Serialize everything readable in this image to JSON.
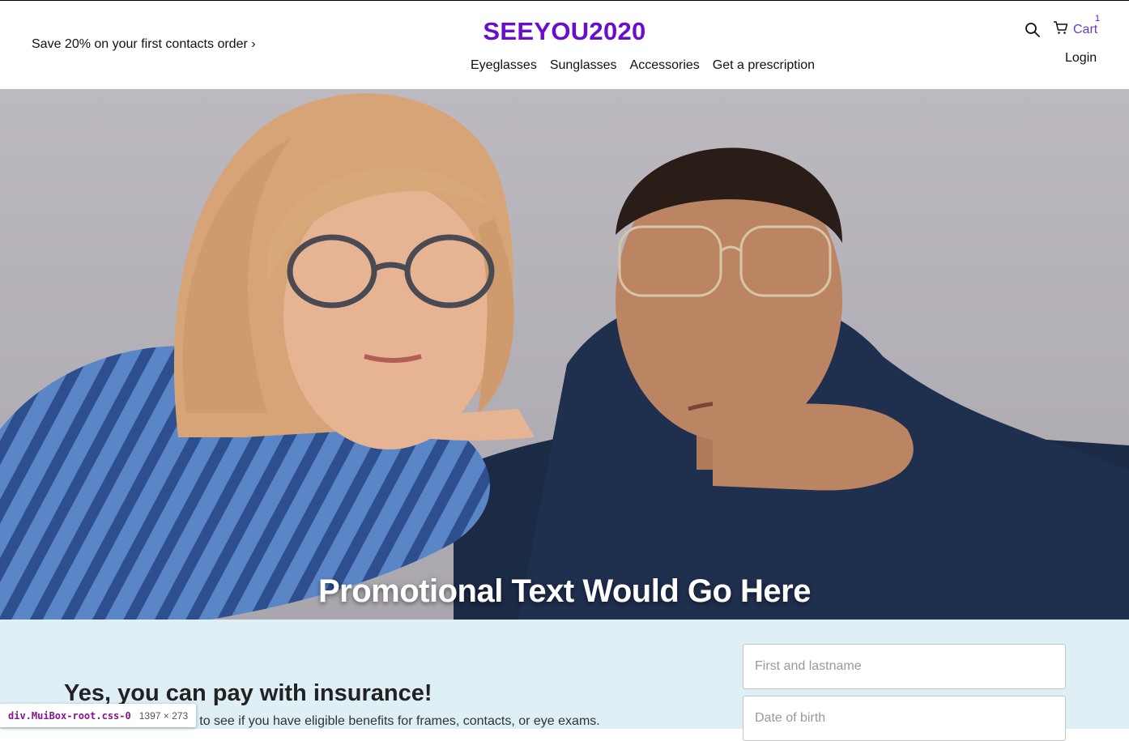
{
  "header": {
    "promo": "Save 20% on your first contacts order ›",
    "brand": "SEEYOU2020",
    "nav": [
      "Eyeglasses",
      "Sunglasses",
      "Accessories",
      "Get a prescription"
    ],
    "cart_label": "Cart",
    "cart_count": "1",
    "login": "Login"
  },
  "hero": {
    "promo_text": "Promotional Text Would Go Here"
  },
  "insurance": {
    "title": "Yes, you can pay with insurance!",
    "subtitle": "on to see if you have eligible benefits for frames, contacts, or eye exams.",
    "name_placeholder": "First and lastname",
    "dob_placeholder": "Date of birth"
  },
  "devtools": {
    "selector": "div.MuiBox-root.css-0",
    "dims": "1397 × 273"
  },
  "colors": {
    "brand": "#6a0dcc",
    "insurance_bg": "#def0f6"
  }
}
